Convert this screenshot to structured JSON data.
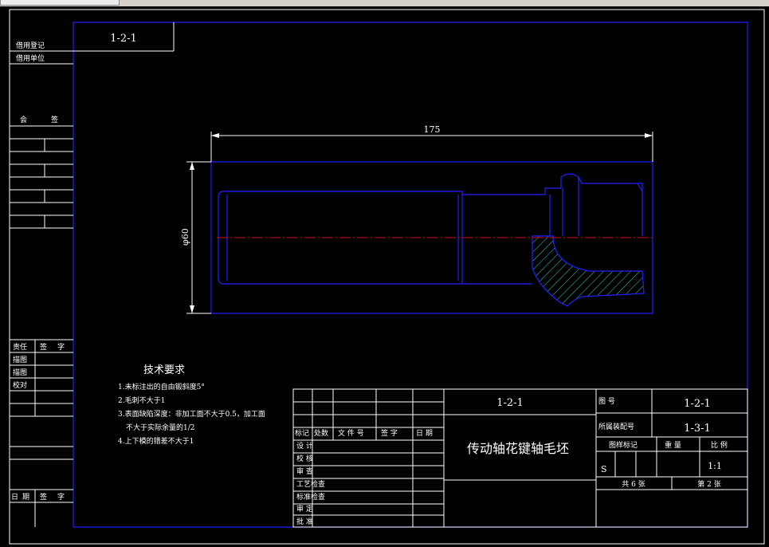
{
  "drawing_number_box": "1-2-1",
  "left_column": {
    "reuse_register": "借用登记",
    "reuse_unit": "借用单位",
    "countersign": [
      "会",
      "签"
    ],
    "responsibility": [
      "责任",
      "签",
      "字"
    ],
    "describe": "描图",
    "trace": "描图",
    "proofread": "校对",
    "date_sign": [
      "日",
      "期",
      "签",
      "字"
    ]
  },
  "part_view": {
    "dim_length": "175",
    "dim_diameter": "φ60"
  },
  "tech_requirements": {
    "heading": "技术要求",
    "items": [
      "1.未标注出的自由锻斜度5°",
      "2.毛刺不大于1",
      "3.表面缺陷深度：非加工面不大于0.5，加工面",
      "不大于实际余量的1/2",
      "4.上下模的错差不大于1"
    ]
  },
  "title_block": {
    "revision_headers": [
      "标记",
      "处数",
      "文 件 号",
      "签  字",
      "日  期"
    ],
    "roles": [
      "设  计",
      "校  核",
      "审  查",
      "工艺检查",
      "标准检查",
      "审  定",
      "批  准"
    ],
    "drawing_code": "1-2-1",
    "part_name": "传动轴花键轴毛坯",
    "drawing_no_label": "图        号",
    "drawing_no_value": "1-2-1",
    "assembly_label": "所属装配号",
    "assembly_value": "1-3-1",
    "sample_mark_label": "图样标记",
    "weight_label": "重    量",
    "scale_label": "比    例",
    "sample_mark_value": "S",
    "scale_value": "1:1",
    "total_sheets": "共  6  张",
    "sheet_no": "第  2  张"
  }
}
